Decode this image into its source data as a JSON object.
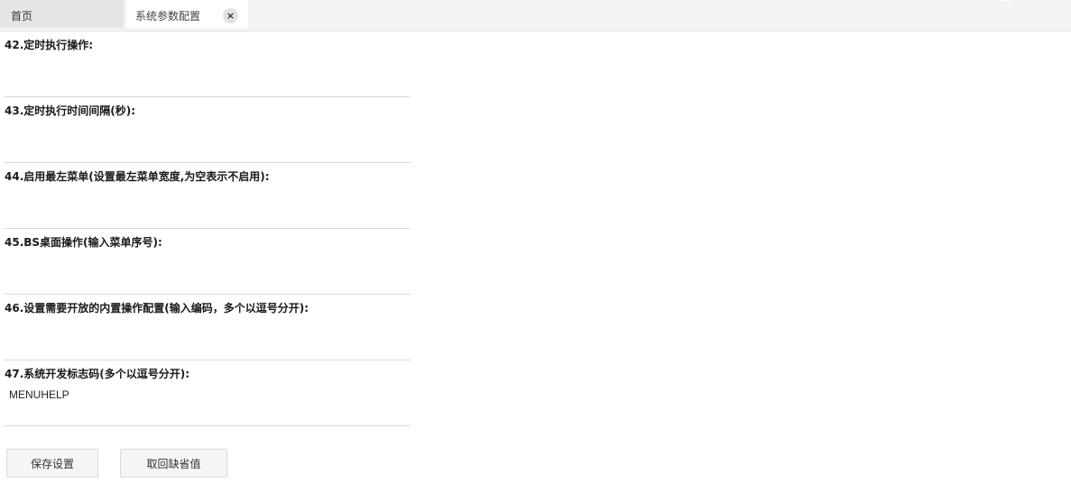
{
  "tabs": {
    "home_label": "首页",
    "active_label": "系统参数配置",
    "close_symbol": "×"
  },
  "fields": [
    {
      "label": "42.定时执行操作:",
      "value": ""
    },
    {
      "label": "43.定时执行时间间隔(秒):",
      "value": ""
    },
    {
      "label": "44.启用最左菜单(设置最左菜单宽度,为空表示不启用):",
      "value": ""
    },
    {
      "label": "45.BS桌面操作(输入菜单序号):",
      "value": ""
    },
    {
      "label": "46.设置需要开放的内置操作配置(输入编码，多个以逗号分开):",
      "value": ""
    },
    {
      "label": "47.系统开发标志码(多个以逗号分开):",
      "value": "MENUHELP"
    }
  ],
  "buttons": {
    "save_label": "保存设置",
    "reset_label": "取回缺省值"
  }
}
